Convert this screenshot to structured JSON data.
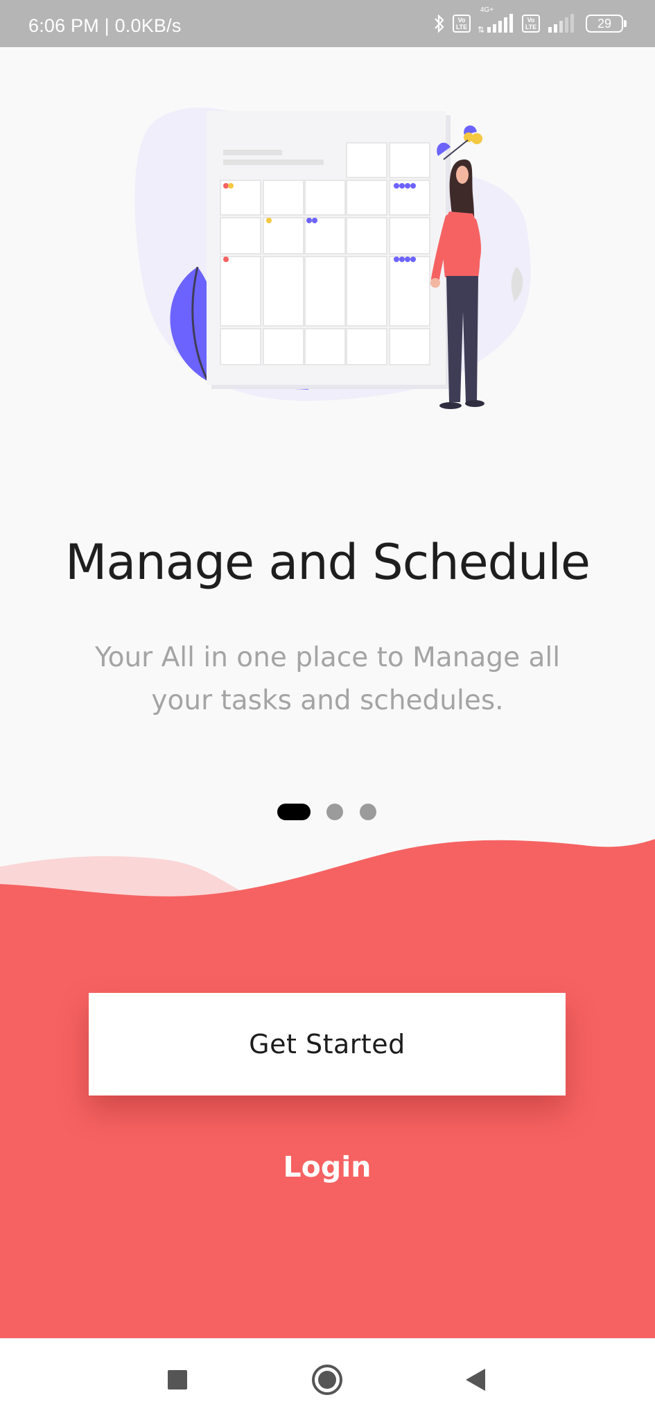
{
  "status_bar": {
    "time": "6:06 PM | 0.0KB/s",
    "network_label": "4G+",
    "volte_label": "Vo LTE",
    "battery": "29",
    "icons": [
      "bluetooth-icon",
      "volte-icon",
      "signal-icon",
      "volte-icon",
      "signal-icon",
      "battery-icon"
    ]
  },
  "onboarding": {
    "illustration": "calendar-schedule-illustration",
    "title": "Manage and Schedule",
    "subtitle": "Your All in one place to Manage all your tasks and schedules.",
    "page_indicator": {
      "total": 3,
      "current": 1
    }
  },
  "actions": {
    "get_started_label": "Get Started",
    "login_label": "Login"
  },
  "navigation": {
    "icons": [
      "recent-apps-icon",
      "home-icon",
      "back-icon"
    ]
  },
  "colors": {
    "status_bar": "#b5b5b5",
    "background": "#f9f9f9",
    "accent": "#f66262",
    "accent_light": "#fbd6d6",
    "illustration_purple": "#6c63ff"
  }
}
